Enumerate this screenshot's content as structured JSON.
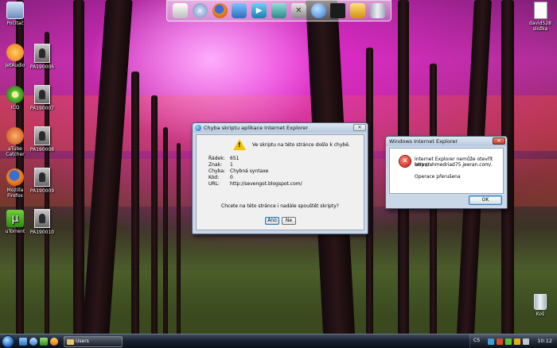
{
  "desktop": {
    "icons_left": [
      {
        "label": "Počítač",
        "icon": "computer-icon",
        "color": "#9fb7d8"
      },
      {
        "label": "jetAudio",
        "icon": "jetaudio-icon",
        "color": "#f08a18"
      },
      {
        "label": "ICQ",
        "icon": "icq-flower-icon",
        "color": "#5bc236"
      },
      {
        "label": "aTube Catcher",
        "icon": "atube-catcher-icon",
        "color": "#d85a1a"
      },
      {
        "label": "Mozilla Firefox",
        "icon": "firefox-icon",
        "color": "#e8701a"
      },
      {
        "label": "uTorrent",
        "icon": "utorrent-icon",
        "color": "#4aa524"
      }
    ],
    "photos": [
      "PA190006",
      "PA190007",
      "PA190008",
      "PA190009",
      "PA190010"
    ],
    "icon_right_top": {
      "label": "david528 složka",
      "icon": "document-icon"
    },
    "icon_recycle": {
      "label": "Koš",
      "icon": "recycle-bin-icon"
    }
  },
  "dock": {
    "items": [
      {
        "icon": "notepad-icon",
        "color": "#d8d8d8"
      },
      {
        "icon": "search-icon",
        "color": "#6c8ab8"
      },
      {
        "icon": "firefox-icon",
        "color": "#e07a18"
      },
      {
        "icon": "folder-icon",
        "color": "#3b8cd0"
      },
      {
        "icon": "media-icon",
        "color": "#2d9fd2"
      },
      {
        "icon": "network-icon",
        "color": "#3aa0a0"
      },
      {
        "icon": "tools-icon",
        "color": "#9a9a9a"
      },
      {
        "icon": "globe-icon",
        "color": "#2f78d0"
      },
      {
        "icon": "tshirt-icon",
        "color": "#222222"
      },
      {
        "icon": "satellite-icon",
        "color": "#e0b020"
      },
      {
        "icon": "trash-icon",
        "color": "#c0c8d0"
      }
    ]
  },
  "script_error": {
    "title": "Chyba skriptu aplikace Internet Explorer",
    "message": "Ve skriptu na této stránce došlo k chybě.",
    "rows": [
      {
        "label": "Řádek:",
        "value": "651"
      },
      {
        "label": "Znak:",
        "value": "1"
      },
      {
        "label": "Chyba:",
        "value": "Chybná syntaxe"
      },
      {
        "label": "Kód:",
        "value": "0"
      },
      {
        "label": "URL:",
        "value": "http://sevengot.blogspot.com/"
      }
    ],
    "question": "Chcete na této stránce i nadále spouštět skripty?",
    "yes_label": "Ano",
    "no_label": "Ne"
  },
  "ie_error": {
    "title": "Windows Internet Explorer",
    "line1": "Internet Explorer nemůže otevřít server",
    "line2": "http://ahmedriad75.jeeran.com/.",
    "line3": "Operace přerušena",
    "ok_label": "OK"
  },
  "taskbar": {
    "task_label": "Users",
    "language": "CS",
    "clock": "10:12"
  }
}
